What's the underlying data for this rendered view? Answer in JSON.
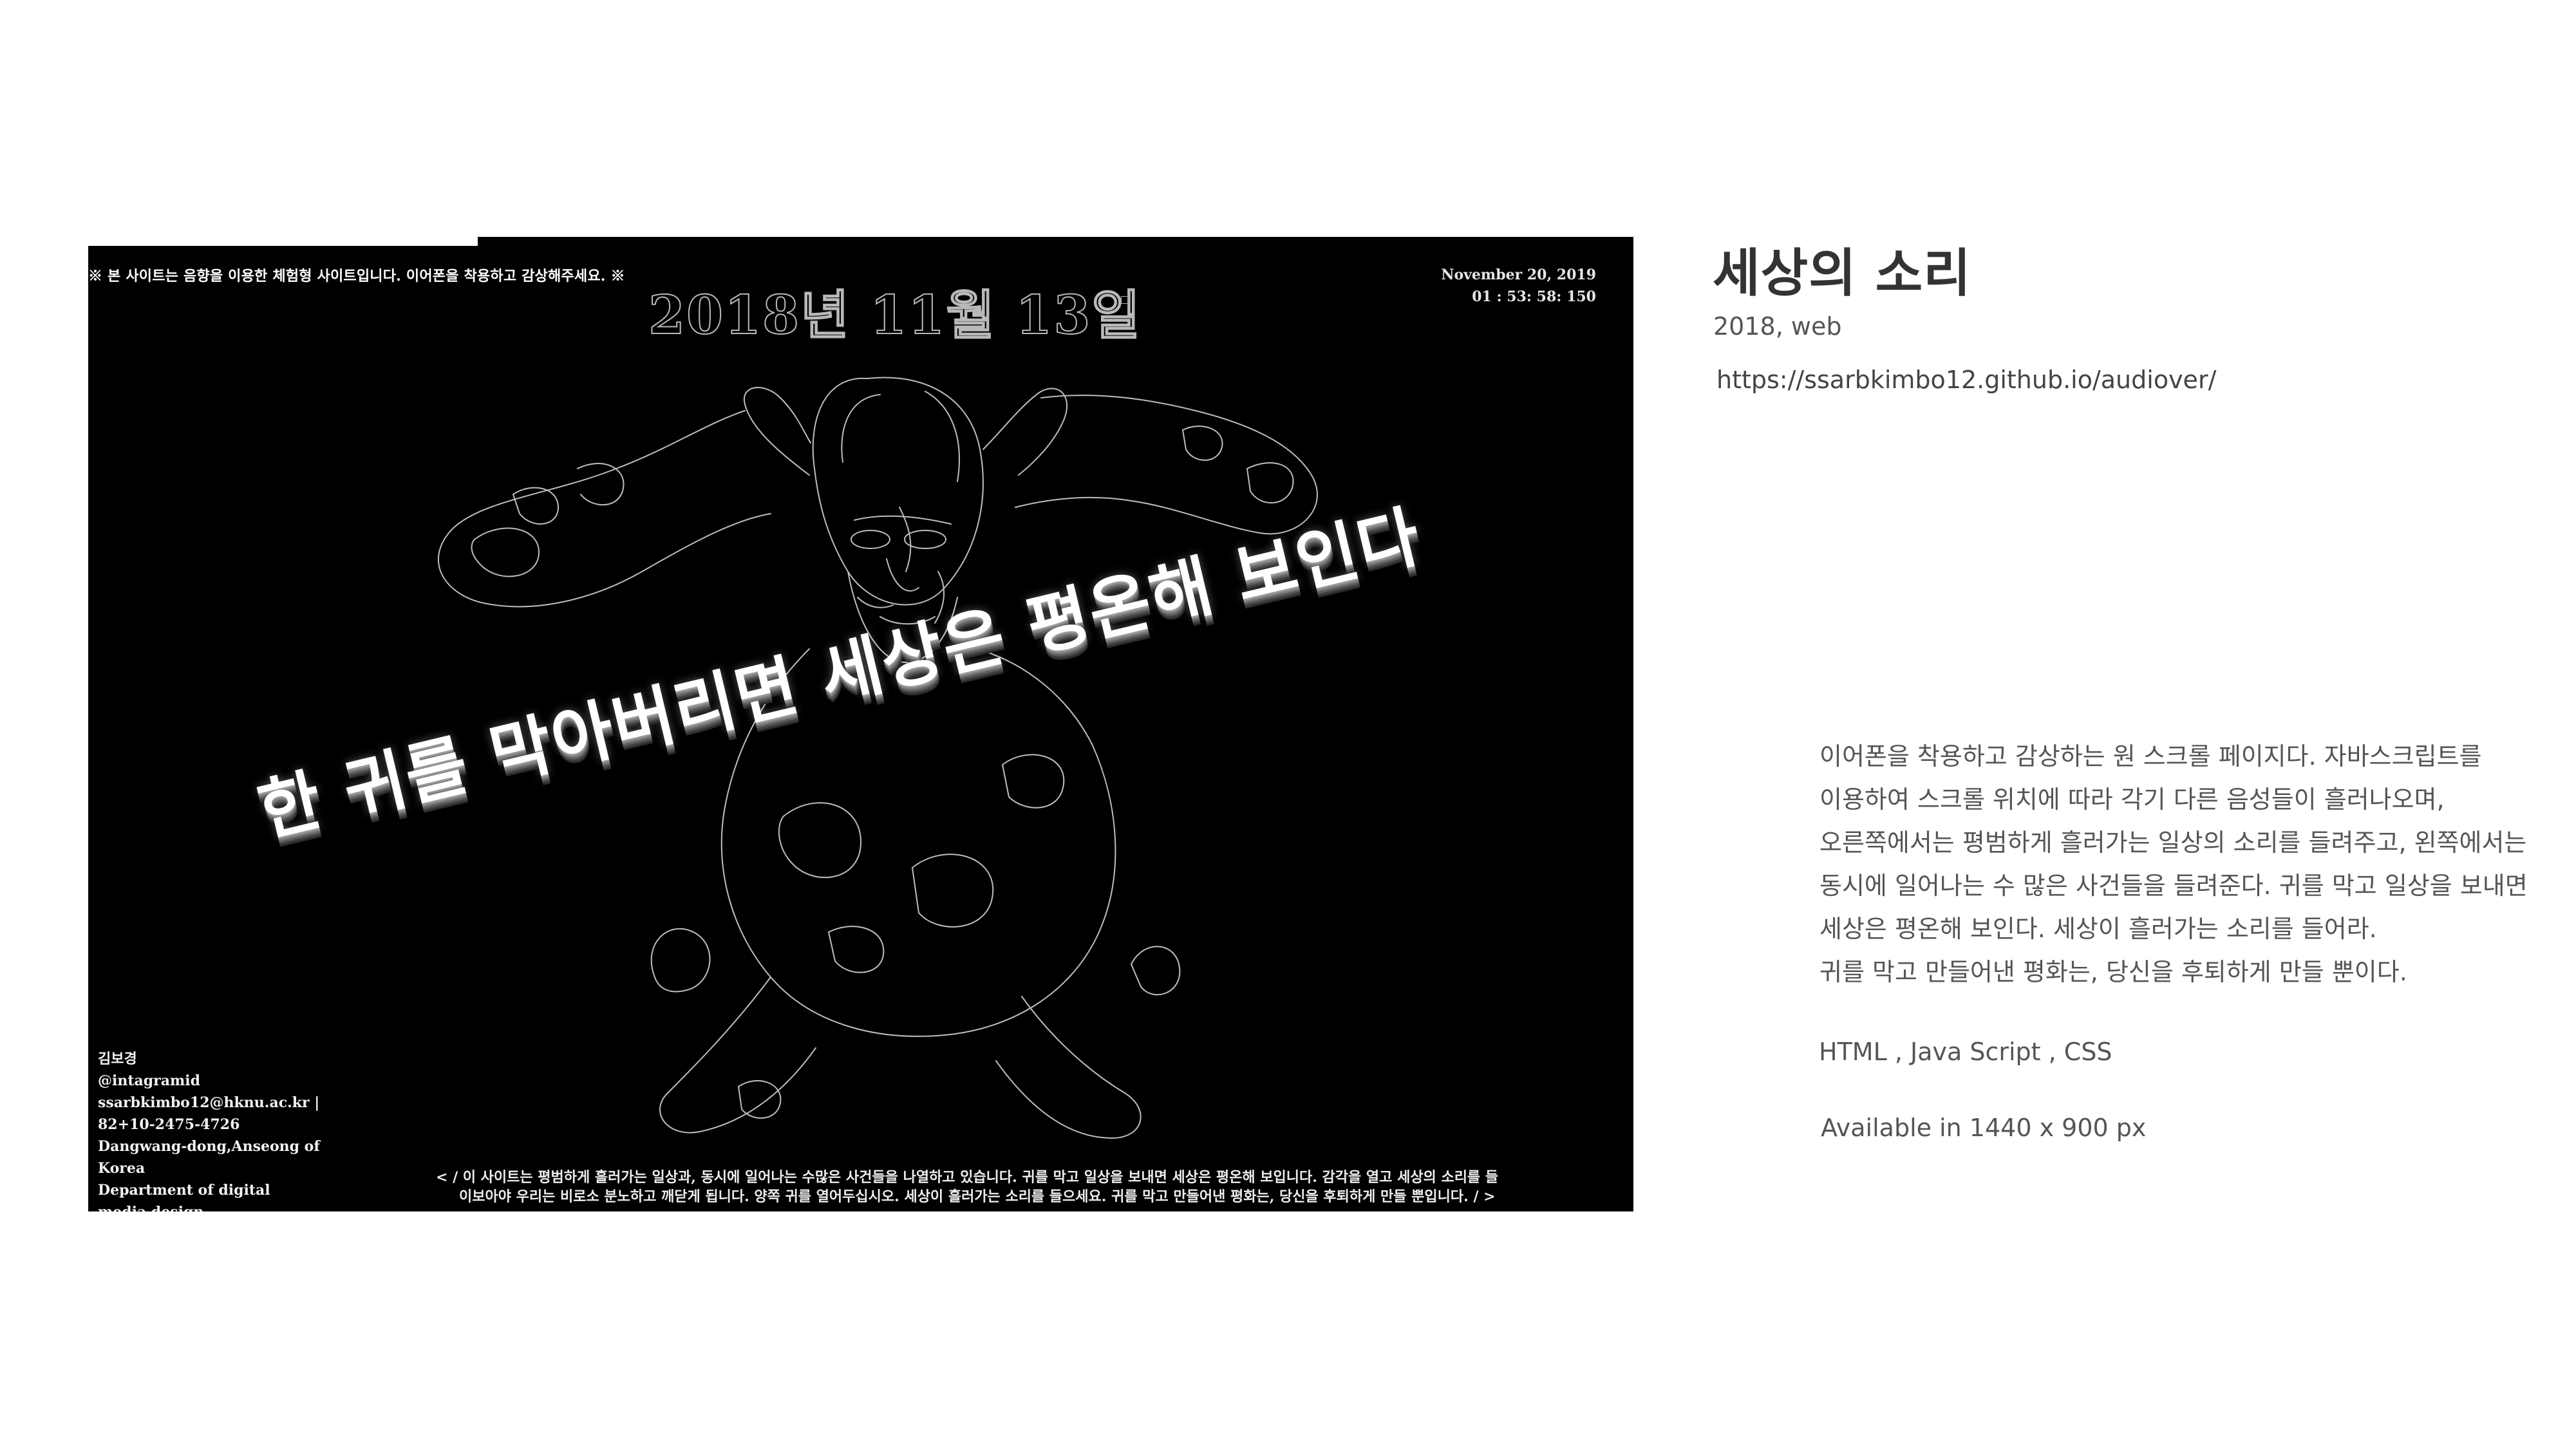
{
  "project": {
    "title": "세상의 소리",
    "meta": "2018, web",
    "url": "https://ssarbkimbo12.github.io/audiover/",
    "description": [
      "이어폰을 착용하고 감상하는 원 스크롤 페이지다. 자바스크립트를",
      "이용하여 스크롤 위치에 따라 각기 다른 음성들이 흘러나오며,",
      "오른쪽에서는 평범하게 흘러가는 일상의 소리를 들려주고, 왼쪽에서는",
      "동시에 일어나는 수 많은 사건들을 들려준다. 귀를 막고 일상을 보내면",
      "세상은 평온해 보인다. 세상이 흘러가는 소리를 들어라.",
      "귀를 막고 만들어낸 평화는, 당신을 후퇴하게 만들 뿐이다."
    ],
    "tech": "HTML , Java Script , CSS",
    "availability": "Available in 1440 x 900 px"
  },
  "screenshot": {
    "notice": "※ 본 사이트는 음향을 이용한 체험형 사이트입니다. 이어폰을 착용하고 감상해주세요. ※",
    "big_date": "2018년 11월 13일",
    "clock_date": "November 20, 2019",
    "clock_time": "01 : 53: 58: 150",
    "headline": "한 귀를 막아버리면 세상은 평온해 보인다",
    "contact": [
      "김보경",
      "@intagramid",
      "ssarbkimbo12@hknu.ac.kr |",
      "82+10-2475-4726",
      "Dangwang-dong,Anseong of",
      "Korea",
      "Department of digital",
      "media design"
    ],
    "ticker_line1": "< / 이 사이트는 평범하게 흘러가는 일상과, 동시에 일어나는 수많은 사건들을 나열하고 있습니다. 귀를 막고 일상을 보내면 세상은 평온해 보입니다. 감각을 열고 세상의 소리를 들",
    "ticker_line2": "이보아야 우리는 비로소 분노하고 깨닫게 됩니다. 양쪽 귀를 열어두십시오. 세상이 흘러가는 소리를 들으세요. 귀를 막고 만들어낸 평화는, 당신을 후퇴하게 만들 뿐입니다. / >"
  },
  "colors": {
    "background": "#ffffff",
    "screenshot_background": "#000000",
    "heading": "#333333",
    "body_text": "#555555"
  },
  "icons": [
    "wireframe-figure-illustration"
  ]
}
